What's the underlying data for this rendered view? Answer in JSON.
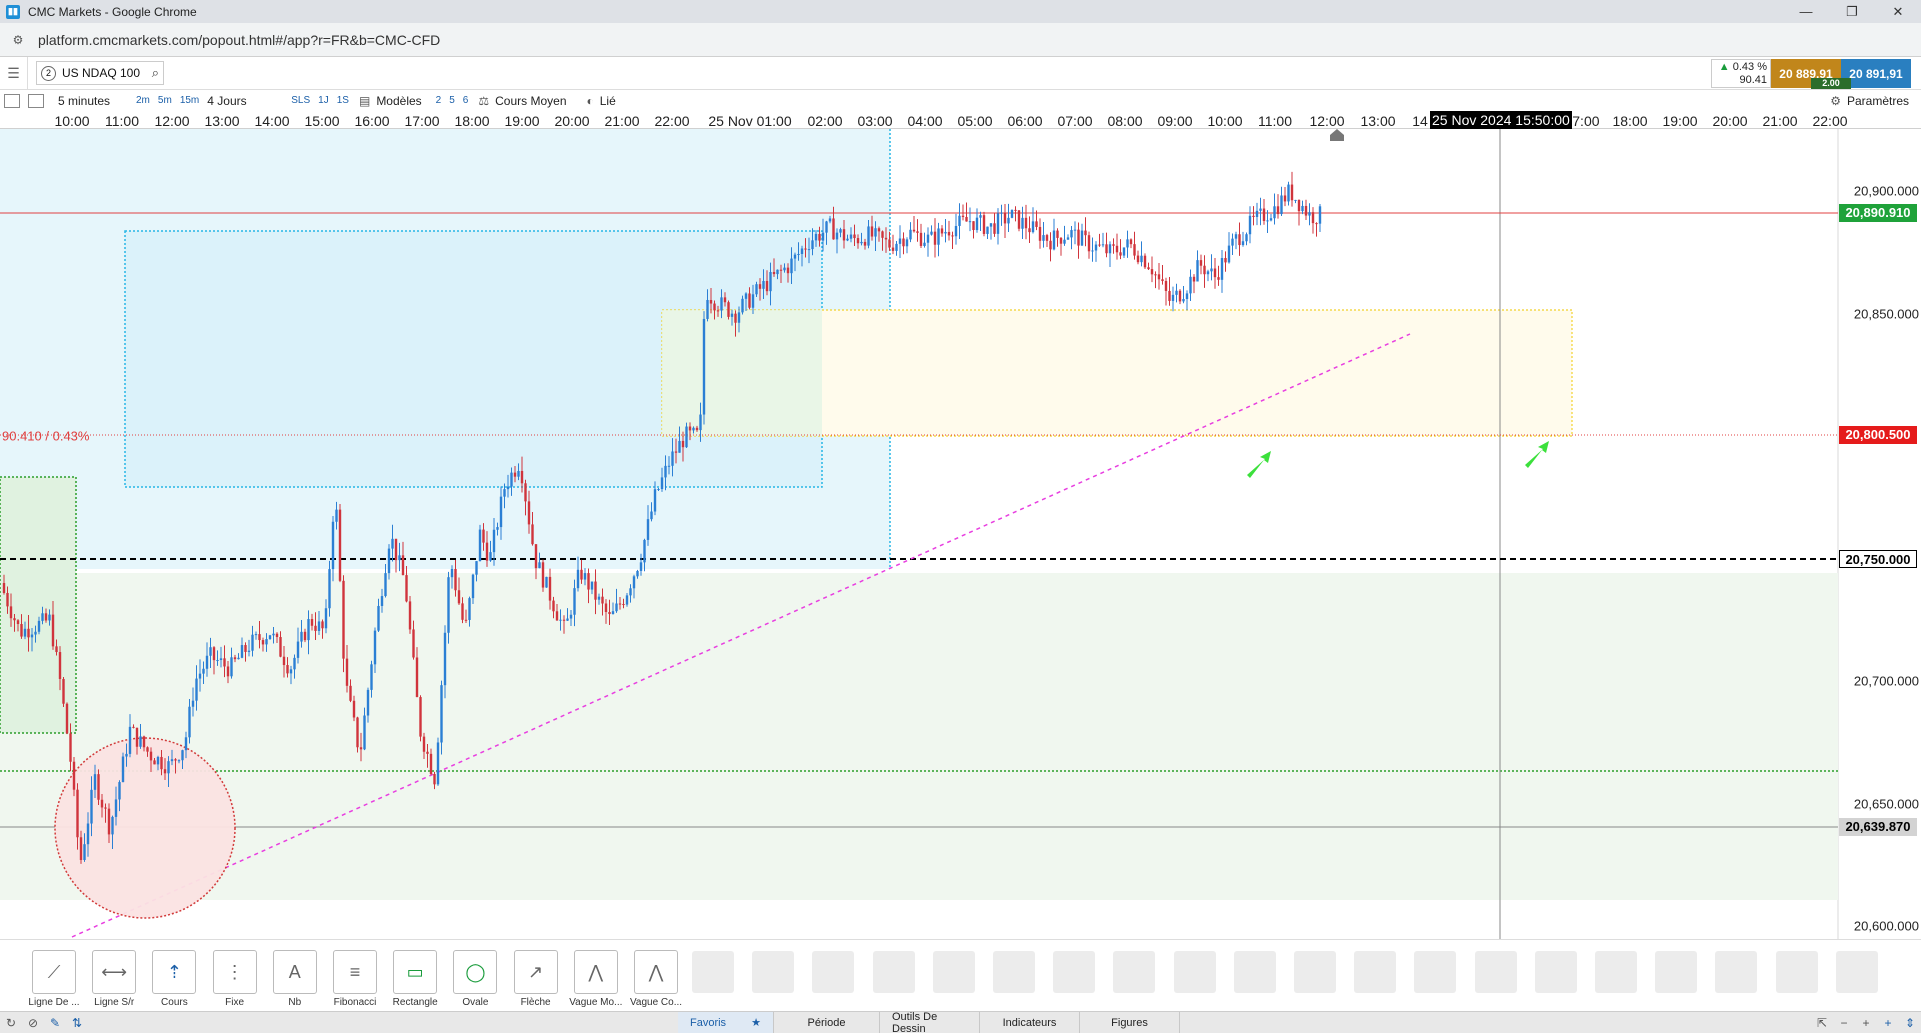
{
  "window": {
    "title": "CMC Markets - Google Chrome",
    "url": "platform.cmcmarkets.com/popout.html#/app?r=FR&b=CMC-CFD"
  },
  "instrument": {
    "badge": "2",
    "name": "US NDAQ 100"
  },
  "prices": {
    "change_pct": "0.43 %",
    "change_pts": "90.41",
    "sell": "20 889,91",
    "buy": "20 891,91",
    "spread": "2.00"
  },
  "toolbar": {
    "interval": "5 minutes",
    "quick_intervals": [
      "2m",
      "5m",
      "15m"
    ],
    "period": "4 Jours",
    "quick_periods": [
      "SLS",
      "1J",
      "1S"
    ],
    "models_label": "Modèles",
    "model_slots": [
      "2",
      "5",
      "6"
    ],
    "price_type": "Cours Moyen",
    "linked_label": "Lié",
    "settings_label": "Paramètres"
  },
  "time_axis": {
    "labels": [
      "10:00",
      "11:00",
      "12:00",
      "13:00",
      "14:00",
      "15:00",
      "16:00",
      "17:00",
      "18:00",
      "19:00",
      "20:00",
      "21:00",
      "22:00",
      "25 Nov 01:00",
      "02:00",
      "03:00",
      "04:00",
      "05:00",
      "06:00",
      "07:00",
      "08:00",
      "09:00",
      "10:00",
      "11:00",
      "12:00",
      "13:00",
      "14",
      "",
      "17:00",
      "18:00",
      "19:00",
      "20:00",
      "21:00",
      "22:00"
    ],
    "cursor_time": "25 Nov 2024 15:50:00"
  },
  "price_axis": {
    "labels": [
      "20,900.000",
      "20,850.000",
      "20,700.000",
      "20,650.000",
      "20,600.000"
    ],
    "current_price": "20,890.910",
    "alert_price": "20,800.500",
    "dashed_level": "20,750.000",
    "cursor_price": "20,639.870",
    "left_label": "90.410 / 0.43%"
  },
  "colors": {
    "up_candle": "#2b7fd4",
    "down_candle": "#d0343c",
    "current_price_tag": "#1fa23a",
    "alert_tag": "#e51b1b",
    "sell_bg": "#c1861b",
    "buy_bg": "#2a7fc0"
  },
  "draw_tools": [
    {
      "label": "Ligne De ...",
      "icon": "trend-line-icon"
    },
    {
      "label": "Ligne S/r",
      "icon": "horizontal-line-icon"
    },
    {
      "label": "Cours",
      "icon": "price-marker-icon"
    },
    {
      "label": "Fixe",
      "icon": "vertical-line-icon"
    },
    {
      "label": "Nb",
      "icon": "text-note-icon"
    },
    {
      "label": "Fibonacci",
      "icon": "fibonacci-icon"
    },
    {
      "label": "Rectangle",
      "icon": "rectangle-icon"
    },
    {
      "label": "Ovale",
      "icon": "ellipse-icon"
    },
    {
      "label": "Flèche",
      "icon": "arrow-icon"
    },
    {
      "label": "Vague Mo...",
      "icon": "wave-icon"
    },
    {
      "label": "Vague Co...",
      "icon": "corrective-wave-icon"
    }
  ],
  "bottom_tabs": {
    "favorites": "Favoris",
    "period": "Période",
    "drawing_tools": "Outils De Dessin",
    "indicators": "Indicateurs",
    "figures": "Figures"
  }
}
